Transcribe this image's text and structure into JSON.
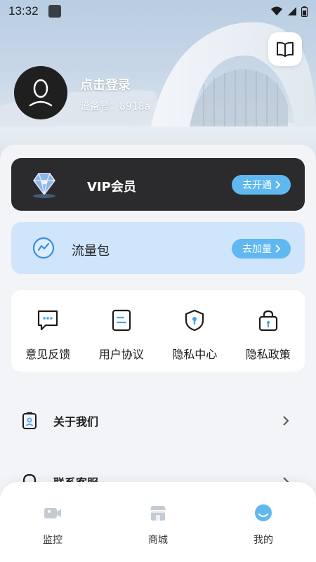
{
  "status_bar": {
    "time": "13:32"
  },
  "profile": {
    "login_label": "点击登录",
    "device_label": "设备号：",
    "device_id": "8918a"
  },
  "vip_card": {
    "label": "VIP会员",
    "button_label": "去开通"
  },
  "data_card": {
    "label": "流量包",
    "button_label": "去加量"
  },
  "quick_actions": [
    {
      "label": "意见反馈",
      "icon": "feedback-icon"
    },
    {
      "label": "用户协议",
      "icon": "agreement-icon"
    },
    {
      "label": "隐私中心",
      "icon": "privacy-shield-icon"
    },
    {
      "label": "隐私政策",
      "icon": "policy-lock-icon"
    }
  ],
  "menu_list": [
    {
      "label": "关于我们",
      "icon": "about-badge-icon"
    },
    {
      "label": "联系客服",
      "icon": "customer-service-icon"
    }
  ],
  "bottom_nav": [
    {
      "label": "监控",
      "icon": "camera-icon",
      "active": false
    },
    {
      "label": "商城",
      "icon": "store-icon",
      "active": false
    },
    {
      "label": "我的",
      "icon": "profile-face-icon",
      "active": true
    }
  ],
  "colors": {
    "accent_blue": "#5fb8ef",
    "vip_card_bg": "#2b2b2d",
    "data_card_bg": "#cfe5fb",
    "nav_active": "#5fb8ef",
    "nav_inactive": "#c5cbd3"
  }
}
